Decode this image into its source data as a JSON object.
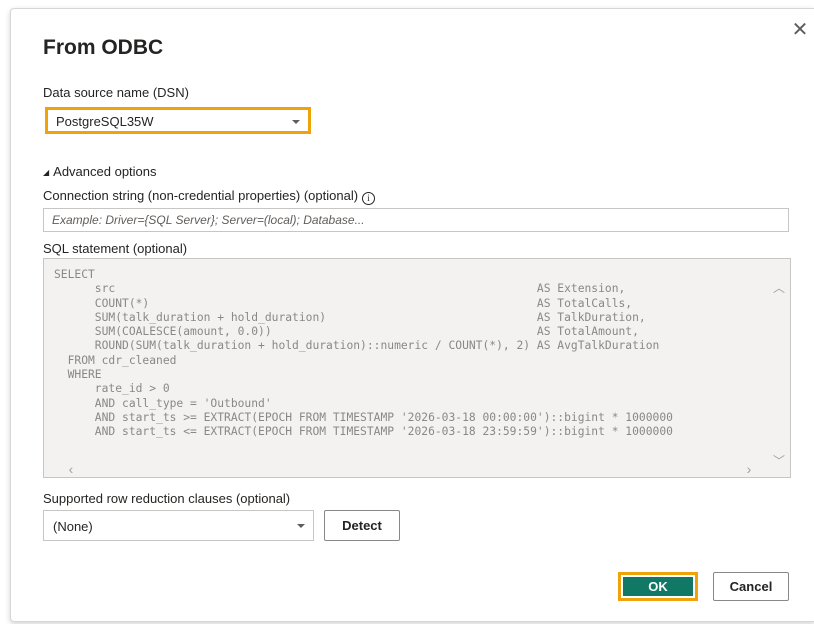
{
  "dialog": {
    "title": "From ODBC",
    "close_icon": "close-icon"
  },
  "dsn": {
    "label": "Data source name (DSN)",
    "selected": "PostgreSQL35W"
  },
  "advanced": {
    "toggle_label": "Advanced options",
    "connection_string_label": "Connection string (non-credential properties) (optional)",
    "connection_string_placeholder": "Example: Driver={SQL Server}; Server=(local); Database...",
    "connection_string_value": "",
    "sql_label": "SQL statement (optional)",
    "sql_text": "SELECT\n      src                                                              AS Extension,\n      COUNT(*)                                                         AS TotalCalls,\n      SUM(talk_duration + hold_duration)                               AS TalkDuration,\n      SUM(COALESCE(amount, 0.0))                                       AS TotalAmount,\n      ROUND(SUM(talk_duration + hold_duration)::numeric / COUNT(*), 2) AS AvgTalkDuration\n  FROM cdr_cleaned\n  WHERE\n      rate_id > 0\n      AND call_type = 'Outbound'\n      AND start_ts >= EXTRACT(EPOCH FROM TIMESTAMP '2026-03-18 00:00:00')::bigint * 1000000\n      AND start_ts <= EXTRACT(EPOCH FROM TIMESTAMP '2026-03-18 23:59:59')::bigint * 1000000"
  },
  "row_reduction": {
    "label": "Supported row reduction clauses (optional)",
    "selected": "(None)",
    "detect_label": "Detect"
  },
  "footer": {
    "ok_label": "OK",
    "cancel_label": "Cancel"
  },
  "colors": {
    "highlight": "#f0a20a",
    "primary_button": "#117865"
  }
}
